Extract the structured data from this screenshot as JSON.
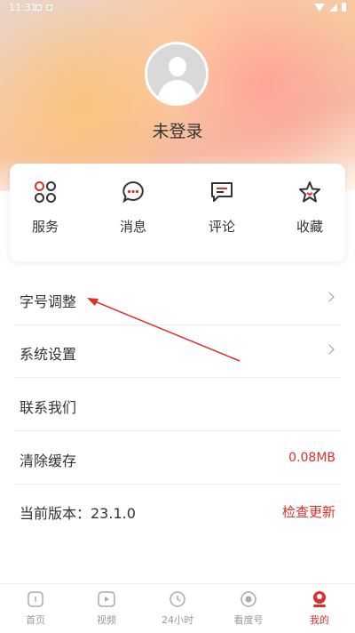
{
  "status_bar": {
    "time": "11:31"
  },
  "profile": {
    "login_label": "未登录"
  },
  "quick_actions": [
    {
      "label": "服务",
      "icon": "services-grid-icon"
    },
    {
      "label": "消息",
      "icon": "message-bubble-icon"
    },
    {
      "label": "评论",
      "icon": "comment-icon"
    },
    {
      "label": "收藏",
      "icon": "star-icon"
    }
  ],
  "settings": {
    "font_size": {
      "label": "字号调整"
    },
    "system": {
      "label": "系统设置"
    },
    "contact": {
      "label": "联系我们"
    },
    "cache": {
      "label": "清除缓存",
      "value": "0.08MB"
    },
    "version": {
      "label": "当前版本：23.1.0",
      "action": "检查更新"
    }
  },
  "bottom_nav": [
    {
      "label": "首页",
      "icon": "home-icon"
    },
    {
      "label": "视频",
      "icon": "video-play-icon"
    },
    {
      "label": "24小时",
      "icon": "clock-24-icon"
    },
    {
      "label": "看度号",
      "icon": "circle-icon"
    },
    {
      "label": "我的",
      "icon": "user-icon"
    }
  ],
  "colors": {
    "accent": "#e0302a",
    "icon_dark": "#333333"
  }
}
